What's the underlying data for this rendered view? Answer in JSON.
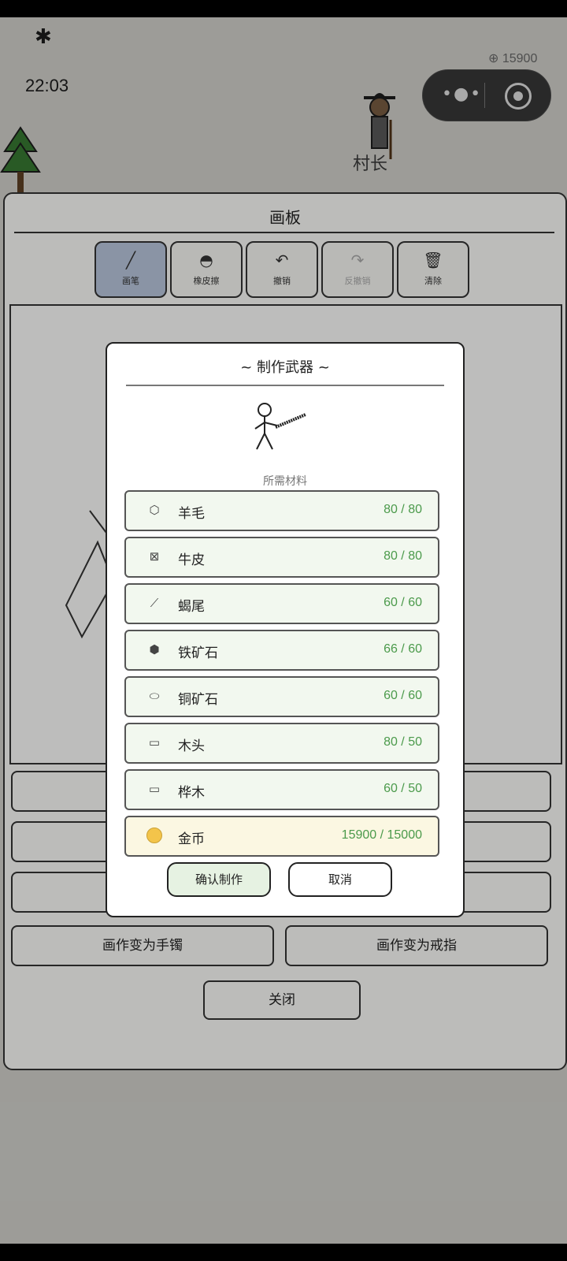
{
  "status": {
    "time": "22:03"
  },
  "world": {
    "coins": "15900",
    "npc_name": "村长"
  },
  "board": {
    "title": "画板",
    "tools": [
      {
        "label": "画笔",
        "icon": "pencil-icon",
        "active": true
      },
      {
        "label": "橡皮擦",
        "icon": "eraser-icon"
      },
      {
        "label": "撤销",
        "icon": "undo-icon"
      },
      {
        "label": "反撤销",
        "icon": "redo-icon",
        "disabled": true
      },
      {
        "label": "清除",
        "icon": "trash-icon"
      }
    ],
    "actions": [
      "画作变为手镯",
      "画作变为戒指"
    ],
    "close_label": "关闭"
  },
  "modal": {
    "title": "~ 制作武器 ~",
    "required_label": "所需材料",
    "materials": [
      {
        "name": "羊毛",
        "count": "80 / 80",
        "icon": "wool-icon"
      },
      {
        "name": "牛皮",
        "count": "80 / 80",
        "icon": "hide-icon"
      },
      {
        "name": "蝎尾",
        "count": "60 / 60",
        "icon": "scorpion-tail-icon"
      },
      {
        "name": "铁矿石",
        "count": "66 / 60",
        "icon": "iron-ore-icon"
      },
      {
        "name": "铜矿石",
        "count": "60 / 60",
        "icon": "copper-ore-icon"
      },
      {
        "name": "木头",
        "count": "80 / 50",
        "icon": "wood-icon"
      },
      {
        "name": "桦木",
        "count": "60 / 50",
        "icon": "birch-icon"
      },
      {
        "name": "金币",
        "count": "15900 / 15000",
        "icon": "gold-coin-icon"
      }
    ],
    "confirm_label": "确认制作",
    "cancel_label": "取消"
  }
}
